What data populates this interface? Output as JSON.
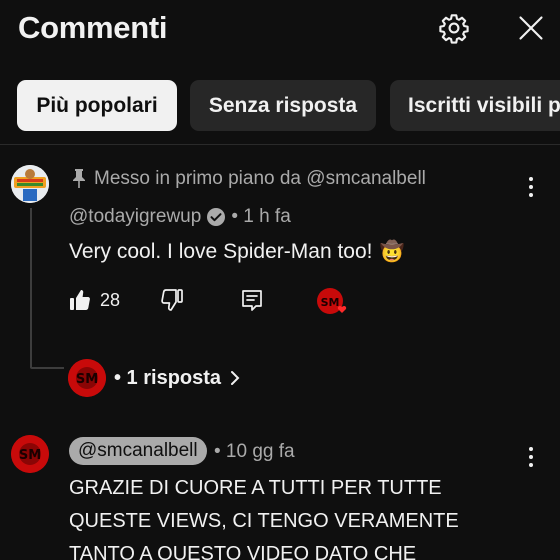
{
  "header": {
    "title": "Commenti",
    "settings_icon": "gear-icon",
    "close_icon": "close-icon"
  },
  "chips": [
    {
      "label": "Più popolari",
      "active": true
    },
    {
      "label": "Senza risposta",
      "active": false
    },
    {
      "label": "Iscritti visibili p",
      "active": false
    }
  ],
  "pinned_comment": {
    "pin_icon": "pin-icon",
    "pinned_label": "Messo in primo piano da @smcanalbell",
    "author": "@todayigrewup",
    "verified_icon": "verified-badge-icon",
    "time": "• 1 h fa",
    "text": "Very cool. I love Spider-Man too!",
    "emoji": "🤠",
    "likes": "28",
    "reply_label": "• 1 risposta"
  },
  "second_comment": {
    "author": "@smcanalbell",
    "time": "• 10 gg fa",
    "lines": [
      "GRAZIE DI CUORE A TUTTI PER TUTTE",
      "QUESTE VIEWS, CI TENGO VERAMENTE",
      "TANTO A QUESTO VIDEO DATO CHE"
    ]
  },
  "colors": {
    "background": "#0f0f0f",
    "chip_active": "#f1f1f1",
    "chip_inactive": "#272727",
    "secondary_text": "#aaaaaa",
    "heart": "#ff2a2a"
  }
}
